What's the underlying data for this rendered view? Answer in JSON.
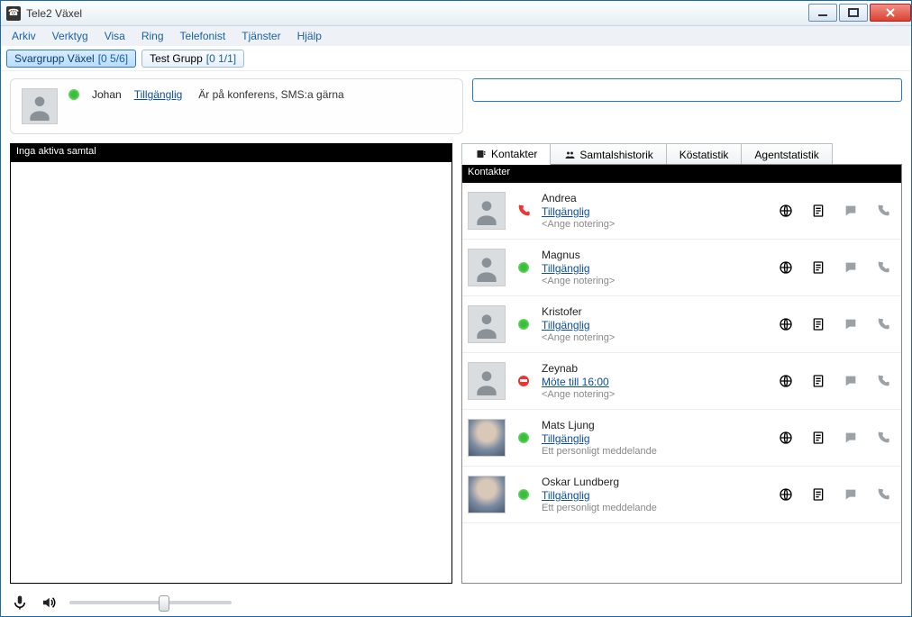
{
  "window": {
    "title": "Tele2 Växel"
  },
  "menubar": [
    "Arkiv",
    "Verktyg",
    "Visa",
    "Ring",
    "Telefonist",
    "Tjänster",
    "Hjälp"
  ],
  "groups": [
    {
      "label": "Svargrupp Växel",
      "count": "[0 5/6]",
      "active": true
    },
    {
      "label": "Test Grupp",
      "count": "[0 1/1]",
      "active": false
    }
  ],
  "user": {
    "name": "Johan",
    "status_link": "Tillgänglig",
    "note": "Är på konferens, SMS:a gärna",
    "presence": "green"
  },
  "search": {
    "placeholder": ""
  },
  "left_panel": {
    "title": "Inga aktiva samtal"
  },
  "tabs": [
    {
      "label": "Kontakter",
      "active": true,
      "icon": "contacts"
    },
    {
      "label": "Samtalshistorik",
      "active": false,
      "icon": "history"
    },
    {
      "label": "Köstatistik",
      "active": false,
      "icon": ""
    },
    {
      "label": "Agentstatistik",
      "active": false,
      "icon": ""
    }
  ],
  "contacts_header": "Kontakter",
  "contacts": [
    {
      "name": "Andrea",
      "status_link": "Tillgänglig",
      "note": "<Ange notering>",
      "presence": "phone",
      "avatar": "generic"
    },
    {
      "name": "Magnus",
      "status_link": "Tillgänglig",
      "note": "<Ange notering>",
      "presence": "green",
      "avatar": "generic"
    },
    {
      "name": "Kristofer",
      "status_link": "Tillgänglig",
      "note": "<Ange notering>",
      "presence": "green",
      "avatar": "generic"
    },
    {
      "name": "Zeynab",
      "status_link": "Möte till 16:00",
      "note": "<Ange notering>",
      "presence": "dnd",
      "avatar": "generic"
    },
    {
      "name": "Mats Ljung",
      "status_link": "Tillgänglig",
      "note": "Ett personligt meddelande",
      "presence": "green",
      "avatar": "photo"
    },
    {
      "name": "Oskar Lundberg",
      "status_link": "Tillgänglig",
      "note": "Ett personligt meddelande",
      "presence": "green",
      "avatar": "photo"
    }
  ],
  "action_icons": [
    "globe-icon",
    "note-icon",
    "chat-icon",
    "call-icon"
  ]
}
